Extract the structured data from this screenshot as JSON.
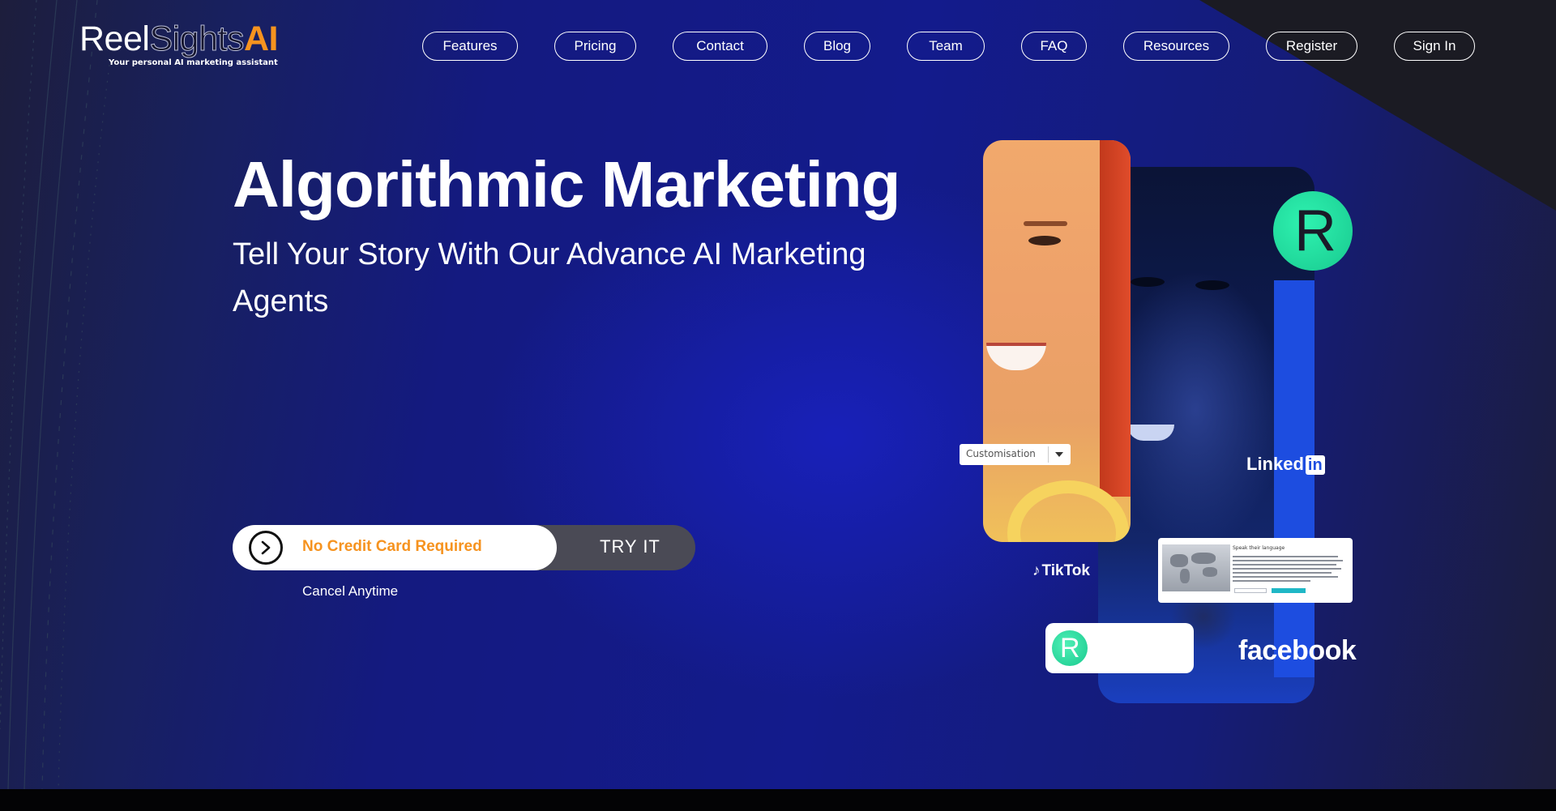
{
  "brand": {
    "logo_reel": "Reel",
    "logo_sights": "Sights",
    "logo_ai": "AI",
    "tagline": "Your personal AI marketing assistant",
    "accent_color": "#f6931f"
  },
  "nav": {
    "items": [
      {
        "label": "Features"
      },
      {
        "label": "Pricing"
      },
      {
        "label": "Contact"
      },
      {
        "label": "Blog"
      },
      {
        "label": "Team"
      },
      {
        "label": "FAQ"
      },
      {
        "label": "Resources"
      },
      {
        "label": "Register"
      },
      {
        "label": "Sign In"
      }
    ]
  },
  "hero": {
    "title": "Algorithmic Marketing",
    "subtitle": "Tell Your Story With Our Advance AI Marketing Agents",
    "cta": {
      "pill_text": "No Credit Card Required",
      "button_label": "TRY IT",
      "icon": "arrow-right-circle-icon",
      "note": "Cancel Anytime"
    }
  },
  "visual": {
    "customisation_select": "Customisation",
    "badge_letter": "R",
    "linkedin_word": "Linked",
    "linkedin_in": "in",
    "tiktok_label": "TikTok",
    "facebook_label": "facebook",
    "preview_heading": "Speak their language"
  }
}
